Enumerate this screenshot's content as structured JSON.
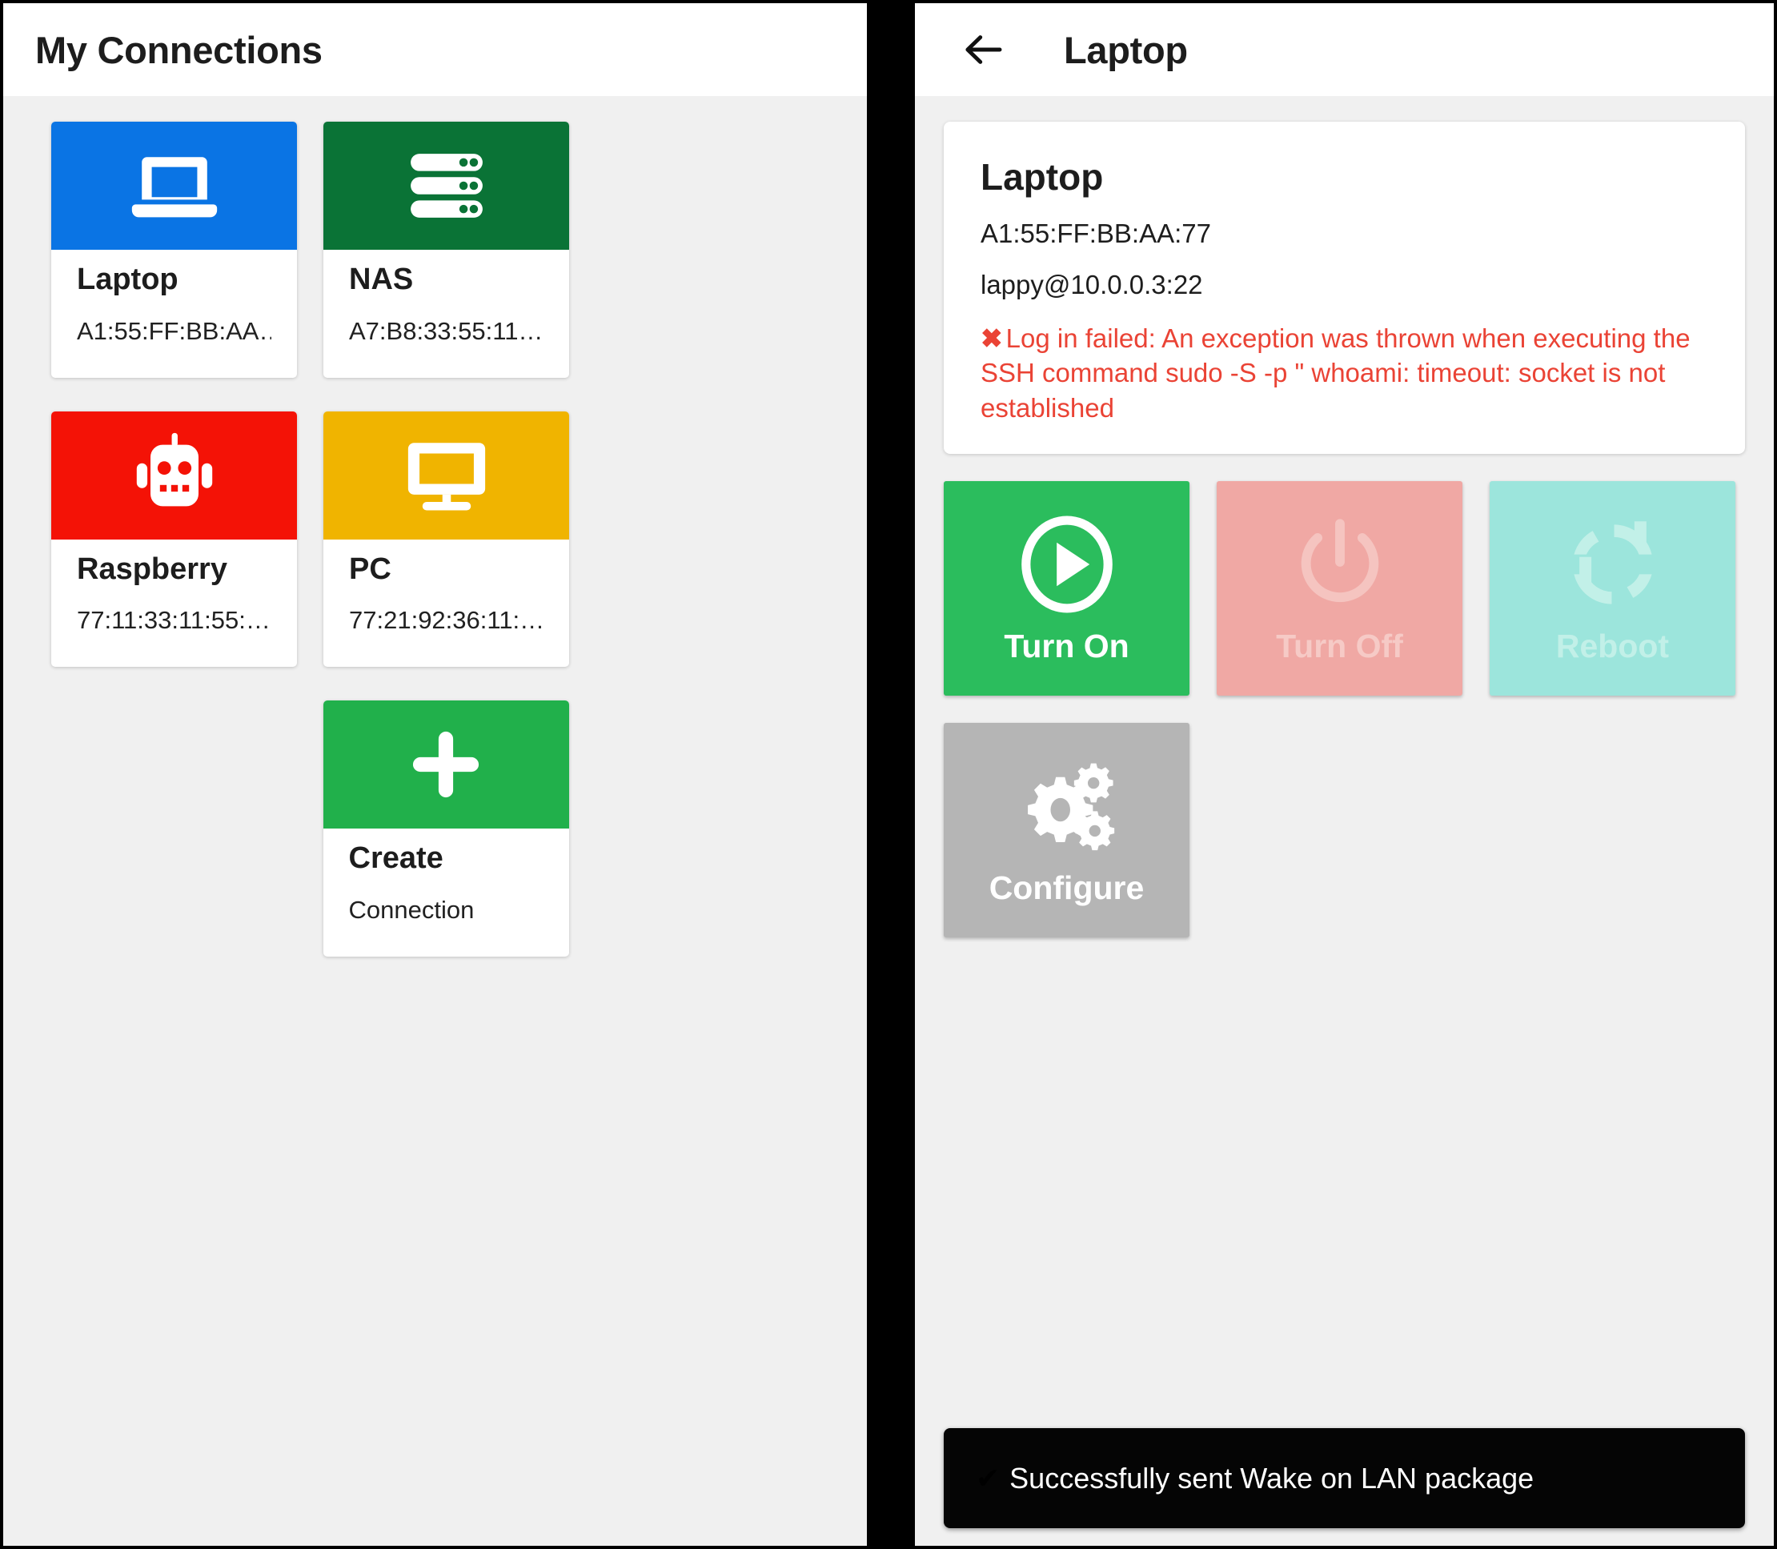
{
  "colors": {
    "laptop_blue": "#0a74e4",
    "nas_green": "#0a7336",
    "raspberry_red": "#f41206",
    "pc_yellow": "#f0b400",
    "create_green": "#21b04b",
    "turn_on_green": "#2bbd5d",
    "turn_off_pink": "#f0a8a4",
    "reboot_teal": "#9ce5dc",
    "configure_gray": "#b5b5b5",
    "error_red": "#ea4335",
    "page_bg": "#f0f0f0",
    "card_white": "#ffffff",
    "snackbar_black": "#050505"
  },
  "left_panel": {
    "appbar": {
      "title": "My Connections"
    },
    "connections": [
      {
        "name": "Laptop",
        "mac": "A1:55:FF:BB:AA…",
        "icon": "laptop-icon",
        "color_key": "laptop_blue"
      },
      {
        "name": "NAS",
        "mac": "A7:B8:33:55:11…",
        "icon": "server-icon",
        "color_key": "nas_green"
      },
      {
        "name": "Raspberry",
        "mac": "77:11:33:11:55:…",
        "icon": "robot-icon",
        "color_key": "raspberry_red"
      },
      {
        "name": "PC",
        "mac": "77:21:92:36:11:…",
        "icon": "monitor-icon",
        "color_key": "pc_yellow"
      }
    ],
    "create_card": {
      "title": "Create",
      "subtitle": "Connection",
      "icon": "plus-icon",
      "color_key": "create_green"
    }
  },
  "right_panel": {
    "appbar": {
      "title": "Laptop",
      "back_icon": "back-arrow-icon"
    },
    "detail": {
      "title": "Laptop",
      "mac": "A1:55:FF:BB:AA:77",
      "ssh": "lappy@10.0.0.3:22",
      "error_marker": "✖",
      "error": "Log in failed: An exception was thrown when executing the SSH command sudo -S -p \" whoami: timeout: socket is not established"
    },
    "actions": [
      {
        "label": "Turn On",
        "icon": "play-circle-icon",
        "color_key": "turn_on_green",
        "enabled": true
      },
      {
        "label": "Turn Off",
        "icon": "power-icon",
        "color_key": "turn_off_pink",
        "enabled": false
      },
      {
        "label": "Reboot",
        "icon": "refresh-icon",
        "color_key": "reboot_teal",
        "enabled": false
      },
      {
        "label": "Configure",
        "icon": "gears-icon",
        "color_key": "configure_gray",
        "enabled": true
      }
    ],
    "snackbar": {
      "check": "✔",
      "message": "Successfully sent Wake on LAN package"
    }
  }
}
